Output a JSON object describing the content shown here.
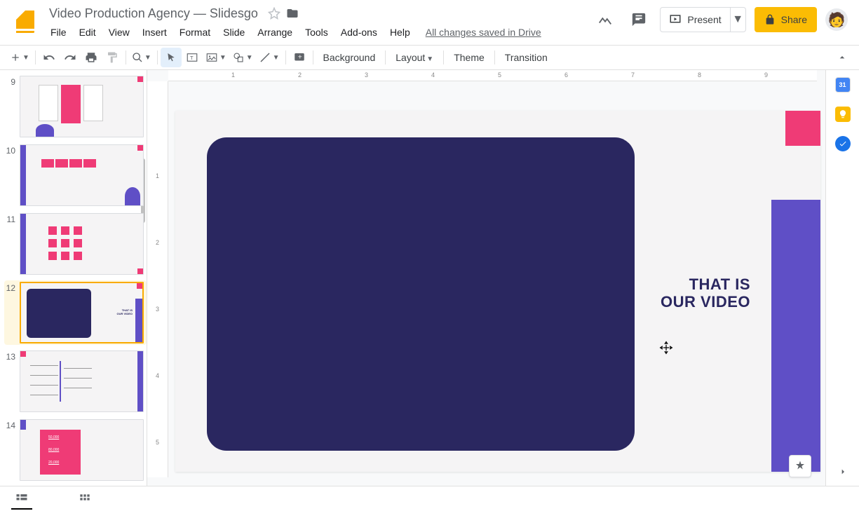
{
  "doc": {
    "title": "Video Production Agency — Slidesgo"
  },
  "menus": [
    "File",
    "Edit",
    "View",
    "Insert",
    "Format",
    "Slide",
    "Arrange",
    "Tools",
    "Add-ons",
    "Help"
  ],
  "saved_status": "All changes saved in Drive",
  "header_buttons": {
    "present": "Present",
    "share": "Share"
  },
  "toolbar": {
    "background": "Background",
    "layout": "Layout",
    "theme": "Theme",
    "transition": "Transition"
  },
  "slides": [
    {
      "num": "9"
    },
    {
      "num": "10"
    },
    {
      "num": "11"
    },
    {
      "num": "12",
      "selected": true
    },
    {
      "num": "13"
    },
    {
      "num": "14"
    }
  ],
  "current_slide": {
    "text_line1": "THAT IS",
    "text_line2": "OUR VIDEO"
  },
  "ruler_h": [
    "1",
    "2",
    "3",
    "4",
    "5",
    "6",
    "7",
    "8",
    "9"
  ],
  "ruler_v": [
    "1",
    "2",
    "3",
    "4",
    "5"
  ],
  "side_panel": {
    "calendar_day": "31"
  },
  "thumb14": {
    "v1": "50,000",
    "v2": "80,000",
    "v3": "20,000"
  }
}
